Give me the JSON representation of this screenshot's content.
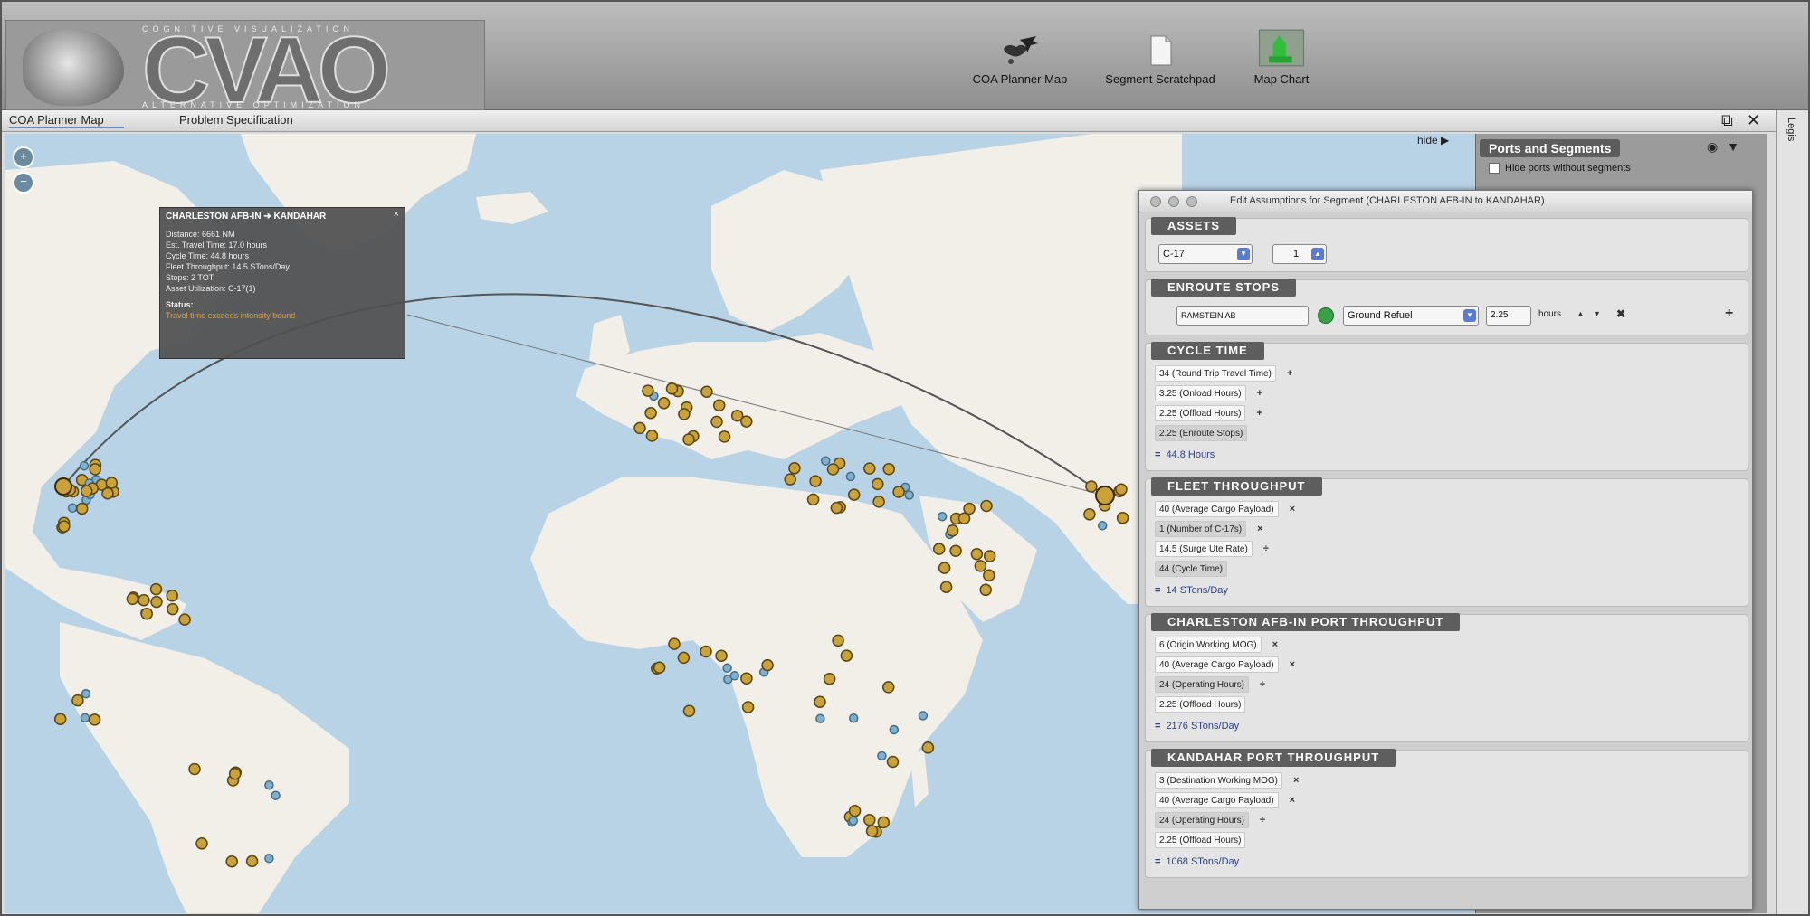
{
  "header": {
    "logo_text": "CVAO",
    "logo_tagline_top": "COGNITIVE VISUALIZATION",
    "logo_tagline_bottom": "ALTERNATIVE OPTIMIZATION",
    "toolbar": [
      {
        "label": "COA Planner Map",
        "icon": "world-map-plane-icon"
      },
      {
        "label": "Segment Scratchpad",
        "icon": "document-icon"
      },
      {
        "label": "Map Chart",
        "icon": "map-chart-icon"
      }
    ]
  },
  "tabs": [
    "COA Planner Map",
    "Problem Specification"
  ],
  "map": {
    "hide_label": "hide ▶",
    "popup": {
      "title": "CHARLESTON AFB-IN ➔ KANDAHAR",
      "lines": [
        "Distance: 6661 NM",
        "Est. Travel Time: 17.0 hours",
        "Cycle Time: 44.8 hours",
        "Fleet Throughput: 14.5 STons/Day",
        "Stops: 2 TOT",
        "Asset Utilization: C-17(1)"
      ],
      "status_label": "Status:",
      "status_text": "Travel time exceeds intensity bound"
    }
  },
  "ports_panel": {
    "title": "Ports and Segments",
    "hide_ports_label": "Hide ports without segments"
  },
  "side_rail": {
    "label": "Legis"
  },
  "dialog": {
    "title": "Edit Assumptions for Segment (CHARLESTON AFB-IN to KANDAHAR)",
    "assets": {
      "header": "ASSETS",
      "aircraft": "C-17",
      "count": "1"
    },
    "enroute": {
      "header": "ENROUTE STOPS",
      "stop": "RAMSTEIN AB",
      "activity": "Ground Refuel",
      "hours": "2.25",
      "unit": "hours"
    },
    "cycle_time": {
      "header": "CYCLE TIME",
      "rows": [
        {
          "text": "34 (Round Trip Travel Time)",
          "op": "+"
        },
        {
          "text": "3.25 (Onload Hours)",
          "op": "+"
        },
        {
          "text": "2.25 (Offload Hours)",
          "op": "+"
        },
        {
          "text": "2.25 (Enroute Stops)",
          "op": ""
        }
      ],
      "result": "44.8 Hours"
    },
    "fleet": {
      "header": "FLEET THROUGHPUT",
      "rows": [
        {
          "text": "40 (Average Cargo Payload)",
          "op": "×"
        },
        {
          "text": "1 (Number of C-17s)",
          "op": "×"
        },
        {
          "text": "14.5 (Surge Ute Rate)",
          "op": "÷"
        },
        {
          "text": "44 (Cycle Time)",
          "op": ""
        }
      ],
      "result": "14 STons/Day"
    },
    "origin": {
      "header": "CHARLESTON AFB-IN PORT THROUGHPUT",
      "rows": [
        {
          "text": "6 (Origin Working MOG)",
          "op": "×"
        },
        {
          "text": "40 (Average Cargo Payload)",
          "op": "×"
        },
        {
          "text": "24 (Operating Hours)",
          "op": "÷"
        },
        {
          "text": "2.25 (Offload Hours)",
          "op": ""
        }
      ],
      "result": "2176 STons/Day"
    },
    "dest": {
      "header": "KANDAHAR PORT THROUGHPUT",
      "rows": [
        {
          "text": "3 (Destination Working MOG)",
          "op": "×"
        },
        {
          "text": "40 (Average Cargo Payload)",
          "op": "×"
        },
        {
          "text": "24 (Operating Hours)",
          "op": "÷"
        },
        {
          "text": "2.25 (Offload Hours)",
          "op": ""
        }
      ],
      "result": "1068 STons/Day"
    }
  }
}
